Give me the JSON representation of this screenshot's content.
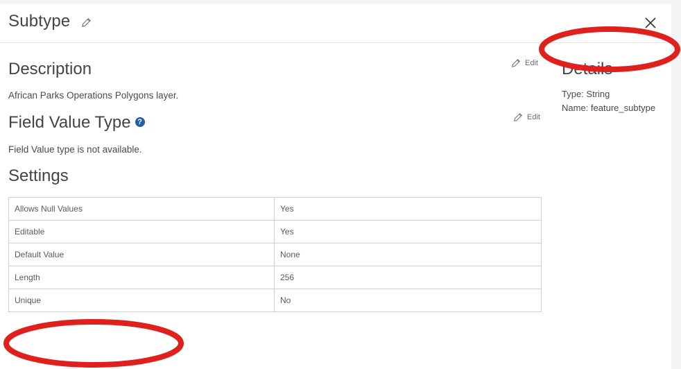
{
  "header": {
    "title": "Subtype",
    "edit_icon": "pencil-icon",
    "close_icon": "close-icon"
  },
  "description": {
    "title": "Description",
    "text": "African Parks Operations Polygons layer.",
    "edit_label": "Edit"
  },
  "field_value_type": {
    "title": "Field Value Type",
    "help_icon": "?",
    "text": "Field Value type is not available.",
    "edit_label": "Edit"
  },
  "settings": {
    "title": "Settings",
    "rows": [
      {
        "label": "Allows Null Values",
        "value": "Yes"
      },
      {
        "label": "Editable",
        "value": "Yes"
      },
      {
        "label": "Default Value",
        "value": "None"
      },
      {
        "label": "Length",
        "value": "256"
      },
      {
        "label": "Unique",
        "value": "No"
      }
    ]
  },
  "details": {
    "title": "Details",
    "type_line": "Type: String",
    "name_line": "Name: feature_subtype"
  },
  "colors": {
    "annotation_red": "#e0201c",
    "help_blue": "#1f5fa6"
  }
}
